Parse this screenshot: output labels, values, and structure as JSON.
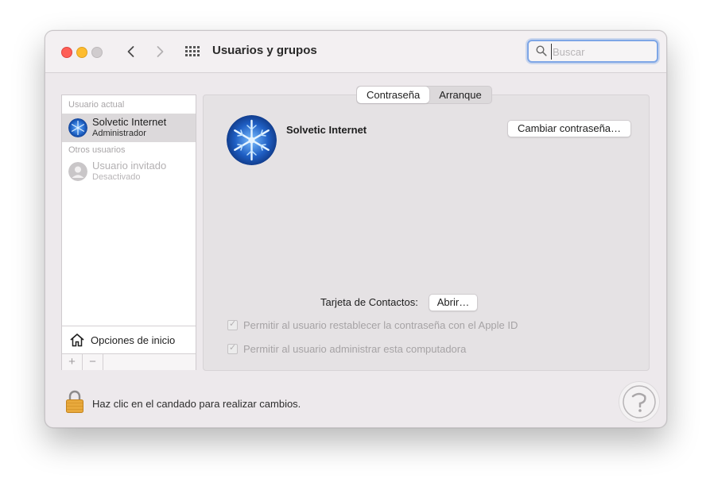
{
  "window": {
    "title": "Usuarios y grupos"
  },
  "search": {
    "placeholder": "Buscar",
    "value": ""
  },
  "sidebar": {
    "current_user_header": "Usuario actual",
    "other_users_header": "Otros usuarios",
    "current_user": {
      "name": "Solvetic Internet",
      "role": "Administrador"
    },
    "other_users": [
      {
        "name": "Usuario invitado",
        "status": "Desactivado"
      }
    ],
    "login_options": "Opciones de inicio",
    "add_button": "+",
    "remove_button": "−"
  },
  "tabs": [
    {
      "label": "Contraseña",
      "active": true
    },
    {
      "label": "Arranque",
      "active": false
    }
  ],
  "main": {
    "user_name": "Solvetic Internet",
    "change_password_button": "Cambiar contraseña…",
    "contact_card_label": "Tarjeta de Contactos:",
    "open_button": "Abrir…",
    "checkbox_reset": "Permitir al usuario restablecer la contraseña con el Apple ID",
    "checkbox_admin": "Permitir al usuario administrar esta computadora"
  },
  "footer": {
    "lock_text": "Haz clic en el candado para realizar cambios."
  },
  "colors": {
    "accent": "#7ea6e6",
    "close": "#fe5f57",
    "minimize": "#febc2e",
    "lock": "#e8a93c"
  }
}
